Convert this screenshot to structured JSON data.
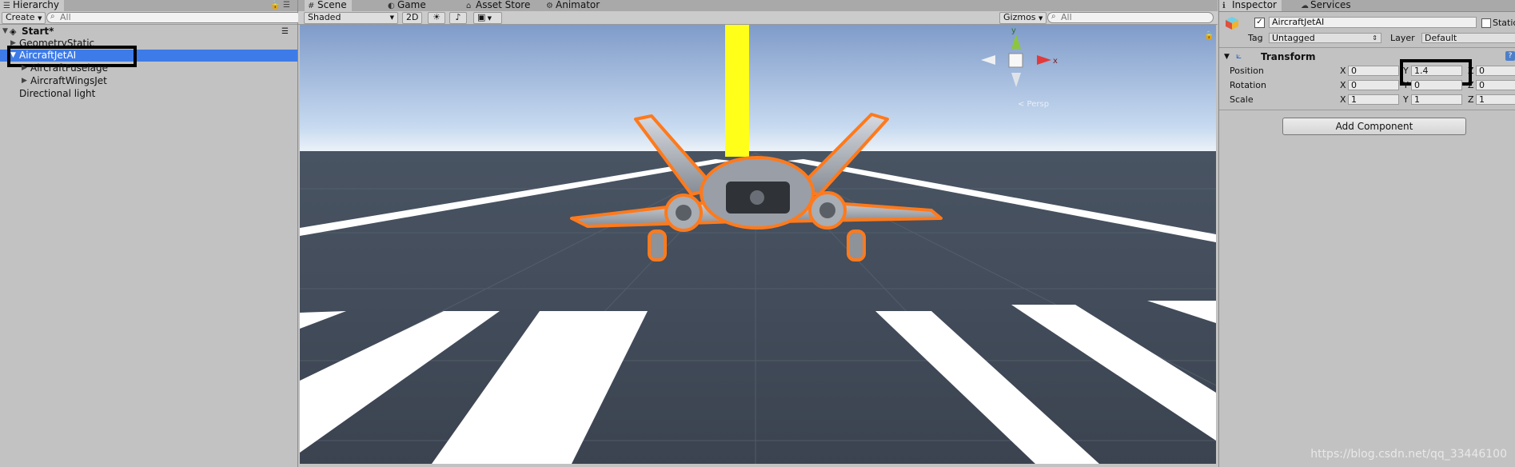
{
  "hierarchy": {
    "tab_label": "Hierarchy",
    "create_label": "Create",
    "search_placeholder": "All",
    "scene_name": "Start*",
    "items": [
      {
        "label": "GeometryStatic"
      },
      {
        "label": "AircraftJetAI"
      },
      {
        "label": "AircraftFuselage"
      },
      {
        "label": "AircraftWingsJet"
      },
      {
        "label": "Directional light"
      }
    ]
  },
  "scene_view": {
    "tabs": [
      {
        "label": "Scene"
      },
      {
        "label": "Game"
      },
      {
        "label": "Asset Store"
      },
      {
        "label": "Animator"
      }
    ],
    "shading_mode": "Shaded",
    "mode_2d_label": "2D",
    "gizmos_label": "Gizmos",
    "search_placeholder": "All",
    "persp_label": "< Persp",
    "gizmo_axis_y": "y",
    "gizmo_axis_x": "x"
  },
  "inspector": {
    "tabs": [
      {
        "label": "Inspector"
      },
      {
        "label": "Services"
      }
    ],
    "object_name": "AircraftJetAI",
    "static_label": "Static",
    "tag_label": "Tag",
    "tag_value": "Untagged",
    "layer_label": "Layer",
    "layer_value": "Default",
    "transform": {
      "title": "Transform",
      "position_label": "Position",
      "rotation_label": "Rotation",
      "scale_label": "Scale",
      "axis_x": "X",
      "axis_y": "Y",
      "axis_z": "Z",
      "position": {
        "x": "0",
        "y": "1.4",
        "z": "0"
      },
      "rotation": {
        "x": "0",
        "y": "0",
        "z": "0"
      },
      "scale": {
        "x": "1",
        "y": "1",
        "z": "1"
      }
    },
    "add_component_label": "Add Component"
  },
  "watermark": "https://blog.csdn.net/qq_33446100",
  "colors": {
    "selection_blue": "#3d7be8",
    "selection_outline": "#ff7a1c",
    "highlight_box": "#000000",
    "yellow_beam": "#ffff1a"
  }
}
